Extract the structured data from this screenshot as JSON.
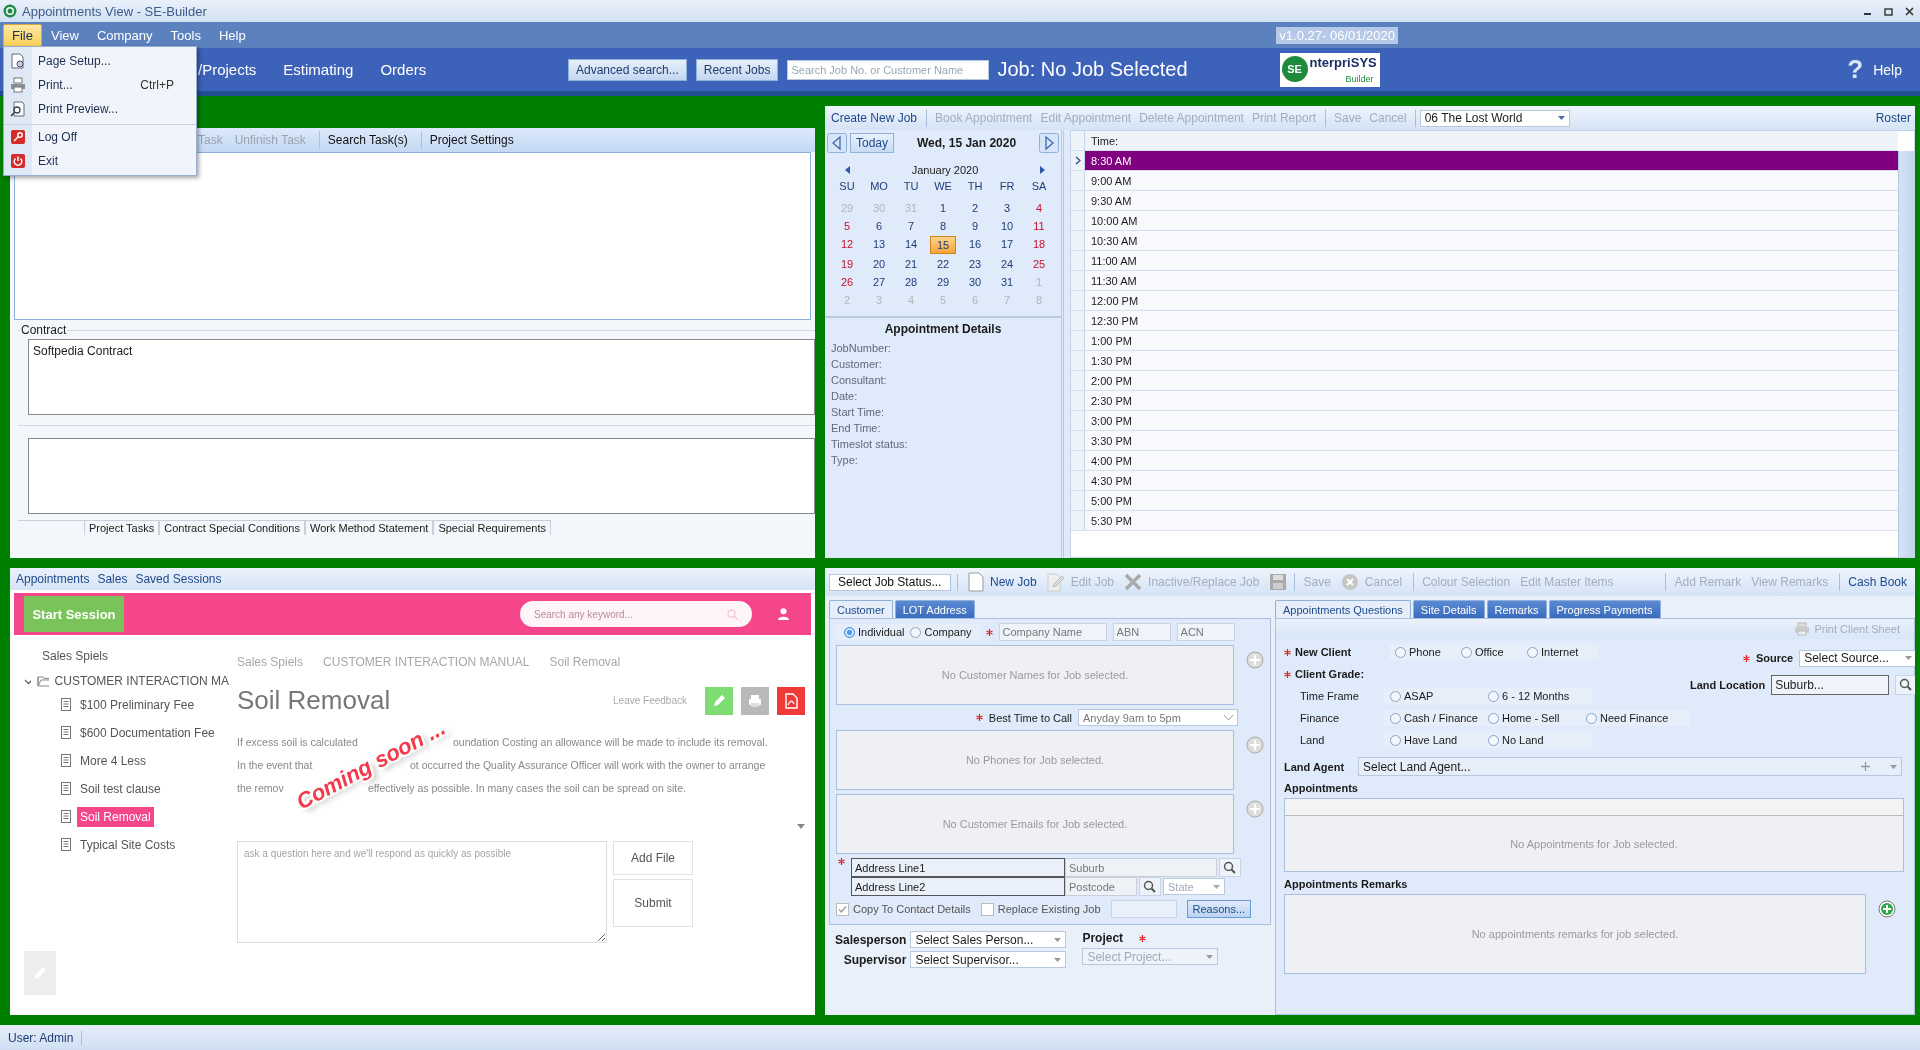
{
  "window": {
    "title": "Appointments View - SE-Builder"
  },
  "menu": [
    {
      "label": "File",
      "selected": true
    },
    {
      "label": "View",
      "selected": false
    },
    {
      "label": "Company",
      "selected": false
    },
    {
      "label": "Tools",
      "selected": false
    },
    {
      "label": "Help",
      "selected": false
    }
  ],
  "version": "v1.0.27- 06/01/2020",
  "file_menu": [
    {
      "label": "Page Setup...",
      "separator_before": false
    },
    {
      "label": "Print...",
      "shortcut": "Ctrl+P",
      "separator_before": false
    },
    {
      "label": "Print Preview...",
      "separator_before": false
    },
    {
      "label": "Log Off",
      "separator_before": true
    },
    {
      "label": "Exit",
      "separator_before": false
    }
  ],
  "header": {
    "nav": [
      "/Projects",
      "Estimating",
      "Orders"
    ],
    "buttons": [
      "Advanced search...",
      "Recent Jobs"
    ],
    "search_placeholder": "Search Job No. or Customer Name",
    "job_title": "Job: No Job Selected",
    "logo": {
      "mark": "SE",
      "name": "nterpriSYS",
      "tagline": "Builder"
    },
    "help_icon": "?",
    "help": "Help"
  },
  "tasks": {
    "toolbar": [
      {
        "label": "Task",
        "disabled": true,
        "separator_before": false
      },
      {
        "label": "Unfinish Task",
        "disabled": true,
        "separator_before": false
      },
      {
        "label": "Search Task(s)",
        "disabled": false,
        "separator_before": true
      },
      {
        "label": "Project Settings",
        "disabled": false,
        "separator_before": true
      }
    ],
    "contract_label": "Contract",
    "contract_text": "Softpedia Contract",
    "tabs": [
      "Project Tasks",
      "Contract Special Conditions",
      "Work Method Statement",
      "Special Requirements"
    ]
  },
  "appointments": {
    "toolbar": [
      {
        "label": "Create New Job",
        "disabled": false,
        "separator_before": false
      },
      {
        "label": "Book Appointment",
        "disabled": true,
        "separator_before": true
      },
      {
        "label": "Edit Appointment",
        "disabled": true,
        "separator_before": false
      },
      {
        "label": "Delete Appointment",
        "disabled": true,
        "separator_before": false
      },
      {
        "label": "Print Report",
        "disabled": true,
        "separator_before": false
      },
      {
        "label": "Save",
        "disabled": true,
        "separator_before": true
      },
      {
        "label": "Cancel",
        "disabled": true,
        "separator_before": false
      }
    ],
    "consultant": "06 The Lost World",
    "roster": "Roster"
  },
  "calendar": {
    "today": "Today",
    "date": "Wed, 15 Jan 2020",
    "month": "January 2020",
    "weekdays": [
      "SU",
      "MO",
      "TU",
      "WE",
      "TH",
      "FR",
      "SA"
    ],
    "weeks": [
      [
        {
          "day": "29",
          "muted": true,
          "selected": false
        },
        {
          "day": "30",
          "muted": true,
          "selected": false
        },
        {
          "day": "31",
          "muted": true,
          "selected": false
        },
        {
          "day": "1",
          "muted": false,
          "selected": false
        },
        {
          "day": "2",
          "muted": false,
          "selected": false
        },
        {
          "day": "3",
          "muted": false,
          "selected": false
        },
        {
          "day": "4",
          "muted": false,
          "selected": false
        }
      ],
      [
        {
          "day": "5",
          "muted": false,
          "selected": false
        },
        {
          "day": "6",
          "muted": false,
          "selected": false
        },
        {
          "day": "7",
          "muted": false,
          "selected": false
        },
        {
          "day": "8",
          "muted": false,
          "selected": false
        },
        {
          "day": "9",
          "muted": false,
          "selected": false
        },
        {
          "day": "10",
          "muted": false,
          "selected": false
        },
        {
          "day": "11",
          "muted": false,
          "selected": false
        }
      ],
      [
        {
          "day": "12",
          "muted": false,
          "selected": false
        },
        {
          "day": "13",
          "muted": false,
          "selected": false
        },
        {
          "day": "14",
          "muted": false,
          "selected": false
        },
        {
          "day": "15",
          "muted": false,
          "selected": true
        },
        {
          "day": "16",
          "muted": false,
          "selected": false
        },
        {
          "day": "17",
          "muted": false,
          "selected": false
        },
        {
          "day": "18",
          "muted": false,
          "selected": false
        }
      ],
      [
        {
          "day": "19",
          "muted": false,
          "selected": false
        },
        {
          "day": "20",
          "muted": false,
          "selected": false
        },
        {
          "day": "21",
          "muted": false,
          "selected": false
        },
        {
          "day": "22",
          "muted": false,
          "selected": false
        },
        {
          "day": "23",
          "muted": false,
          "selected": false
        },
        {
          "day": "24",
          "muted": false,
          "selected": false
        },
        {
          "day": "25",
          "muted": false,
          "selected": false
        }
      ],
      [
        {
          "day": "26",
          "muted": false,
          "selected": false
        },
        {
          "day": "27",
          "muted": false,
          "selected": false
        },
        {
          "day": "28",
          "muted": false,
          "selected": false
        },
        {
          "day": "29",
          "muted": false,
          "selected": false
        },
        {
          "day": "30",
          "muted": false,
          "selected": false
        },
        {
          "day": "31",
          "muted": false,
          "selected": false
        },
        {
          "day": "1",
          "muted": true,
          "selected": false
        }
      ],
      [
        {
          "day": "2",
          "muted": true,
          "selected": false
        },
        {
          "day": "3",
          "muted": true,
          "selected": false
        },
        {
          "day": "4",
          "muted": true,
          "selected": false
        },
        {
          "day": "5",
          "muted": true,
          "selected": false
        },
        {
          "day": "6",
          "muted": true,
          "selected": false
        },
        {
          "day": "7",
          "muted": true,
          "selected": false
        },
        {
          "day": "8",
          "muted": true,
          "selected": false
        }
      ]
    ]
  },
  "details": {
    "title": "Appointment Details",
    "fields": [
      "JobNumber:",
      "Customer:",
      "Consultant:",
      "Date:",
      "Start Time:",
      "End Time:",
      "Timeslot status:",
      "Type:"
    ]
  },
  "schedule": {
    "header": "Time:",
    "slots": [
      {
        "time": "8:30 AM",
        "selected": true
      },
      {
        "time": "9:00 AM",
        "selected": false
      },
      {
        "time": "9:30 AM",
        "selected": false
      },
      {
        "time": "10:00 AM",
        "selected": false
      },
      {
        "time": "10:30 AM",
        "selected": false
      },
      {
        "time": "11:00 AM",
        "selected": false
      },
      {
        "time": "11:30 AM",
        "selected": false
      },
      {
        "time": "12:00 PM",
        "selected": false
      },
      {
        "time": "12:30 PM",
        "selected": false
      },
      {
        "time": "1:00 PM",
        "selected": false
      },
      {
        "time": "1:30 PM",
        "selected": false
      },
      {
        "time": "2:00 PM",
        "selected": false
      },
      {
        "time": "2:30 PM",
        "selected": false
      },
      {
        "time": "3:00 PM",
        "selected": false
      },
      {
        "time": "3:30 PM",
        "selected": false
      },
      {
        "time": "4:00 PM",
        "selected": false
      },
      {
        "time": "4:30 PM",
        "selected": false
      },
      {
        "time": "5:00 PM",
        "selected": false
      },
      {
        "time": "5:30 PM",
        "selected": false
      }
    ]
  },
  "sales": {
    "links": [
      "Appointments",
      "Sales",
      "Saved Sessions"
    ],
    "start_session": "Start Session",
    "search_placeholder": "Search any keyword...",
    "sidebar_title": "Sales Spiels",
    "folder": {
      "label": "CUSTOMER INTERACTION MA",
      "expanded": true,
      "children": [
        {
          "label": "$100 Preliminary Fee",
          "selected": false
        },
        {
          "label": "$600 Documentation Fee",
          "selected": false
        },
        {
          "label": "More 4 Less",
          "selected": false
        },
        {
          "label": "Soil test clause",
          "selected": false
        },
        {
          "label": "Soil Removal",
          "selected": true
        },
        {
          "label": "Typical Site Costs",
          "selected": false
        }
      ]
    },
    "breadcrumb": [
      "Sales Spiels",
      "CUSTOMER INTERACTION MANUAL",
      "Soil Removal"
    ],
    "title": "Soil Removal",
    "feedback": "Leave Feedback",
    "lines": [
      [
        "If excess soil is calculated",
        "oundation Costing an allowance will be made to include its removal."
      ],
      [
        "In the event that",
        "ot occurred the Quality Assurance Officer will work with the owner to arrange"
      ],
      [
        "the remov",
        "effectively as possible. In many cases the soil can be spread on site."
      ]
    ],
    "overlay": "Coming soon ...",
    "question_placeholder": "ask a question here and we'll respond as quickly as possible",
    "buttons": [
      "Add File",
      "Submit"
    ]
  },
  "job": {
    "status": "Select Job Status...",
    "toolbar": [
      {
        "label": "New Job",
        "disabled": false,
        "separator_before": false
      },
      {
        "label": "Edit Job",
        "disabled": true,
        "separator_before": false
      },
      {
        "label": "Inactive/Replace Job",
        "disabled": true,
        "separator_before": false
      },
      {
        "label": "Save",
        "disabled": true,
        "separator_before": true
      },
      {
        "label": "Cancel",
        "disabled": true,
        "separator_before": false
      },
      {
        "label": "Colour Selection",
        "disabled": true,
        "separator_before": true
      },
      {
        "label": "Edit Master Items",
        "disabled": true,
        "separator_before": false
      },
      {
        "label": "Add Remark",
        "disabled": true,
        "separator_before": true
      },
      {
        "label": "View Remarks",
        "disabled": true,
        "separator_before": false
      },
      {
        "label": "Cash Book",
        "disabled": false,
        "separator_before": true
      }
    ],
    "tabs": [
      {
        "label": "Customer",
        "selected": true
      },
      {
        "label": "LOT Address",
        "selected": false
      }
    ],
    "client_type": [
      {
        "label": "Individual",
        "selected": true
      },
      {
        "label": "Company",
        "selected": false
      }
    ],
    "company_fields": [
      {
        "placeholder": "Company Name"
      },
      {
        "placeholder": "ABN"
      },
      {
        "placeholder": "ACN"
      }
    ],
    "names_empty": "No Customer Names for Job selected.",
    "best_time": {
      "label": "Best Time to Call",
      "value": "Anyday 9am to 5pm"
    },
    "phones_empty": "No Phones for Job selected.",
    "emails_empty": "No Customer Emails for Job selected.",
    "address": {
      "line1": "Address Line1",
      "line2": "Address Line2",
      "suburb": {
        "placeholder": "Suburb"
      },
      "postcode": {
        "placeholder": "Postcode"
      },
      "state": {
        "placeholder": "State"
      }
    },
    "copy": {
      "label": "Copy To Contact Details",
      "checked": true
    },
    "replace": {
      "label": "Replace Existing Job",
      "checked": false
    },
    "reasons": "Reasons...",
    "salesperson": {
      "label": "Salesperson",
      "value": "Select Sales Person..."
    },
    "supervisor": {
      "label": "Supervisor",
      "value": "Select Supervisor..."
    },
    "project": {
      "label": "Project",
      "placeholder": "Select Project..."
    }
  },
  "questions": {
    "tabs": [
      {
        "label": "Appointments Questions",
        "selected": true
      },
      {
        "label": "Site Details",
        "selected": false
      },
      {
        "label": "Remarks",
        "selected": false
      },
      {
        "label": "Progress Payments",
        "selected": false
      }
    ],
    "print": "Print Client Sheet",
    "new_client": {
      "label": "New Client",
      "options": [
        {
          "label": "Phone",
          "selected": false
        },
        {
          "label": "Office",
          "selected": false
        },
        {
          "label": "Internet",
          "selected": false
        }
      ]
    },
    "grade_label": "Client Grade:",
    "grades": [
      {
        "label": "Time Frame",
        "options": [
          {
            "label": "ASAP",
            "selected": false
          },
          {
            "label": "6 - 12 Months",
            "selected": false
          }
        ]
      },
      {
        "label": "Finance",
        "options": [
          {
            "label": "Cash / Finance",
            "selected": false
          },
          {
            "label": "Home - Sell",
            "selected": false
          },
          {
            "label": "Need Finance",
            "selected": false
          }
        ]
      },
      {
        "label": "Land",
        "options": [
          {
            "label": "Have Land",
            "selected": false
          },
          {
            "label": "No Land",
            "selected": false
          }
        ]
      }
    ],
    "source": {
      "label": "Source",
      "value": "Select Source..."
    },
    "land_location": {
      "label": "Land Location",
      "placeholder": "Suburb..."
    },
    "land_agent": {
      "label": "Land Agent",
      "value": "Select Land Agent..."
    },
    "appointments_title": "Appointments",
    "appointments_empty": "No Appointments for Job selected.",
    "remarks_title": "Appointments Remarks",
    "remarks_empty": "No appointments remarks for job selected."
  },
  "status_bar": "User: Admin"
}
